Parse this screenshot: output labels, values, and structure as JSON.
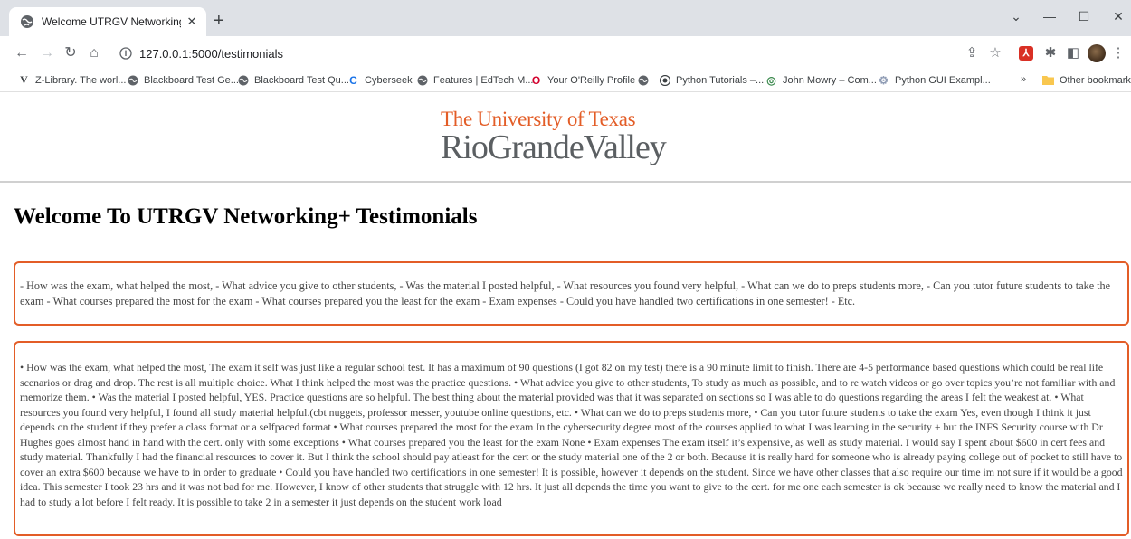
{
  "browser": {
    "tab_title": "Welcome UTRGV Networking+ T",
    "tab_close": "✕",
    "new_tab": "+",
    "url": "127.0.0.1:5000/testimonials",
    "window_controls": {
      "chevron": "⌄",
      "minimize": "—",
      "maximize": "☐",
      "close": "✕"
    },
    "nav": {
      "back": "←",
      "forward": "→",
      "reload": "↻",
      "home": "⌂"
    },
    "toolbar_icons": [
      "share-icon",
      "star-icon",
      "pdf-extension-icon",
      "extensions-puzzle-icon",
      "side-panel-icon",
      "profile-avatar-icon",
      "menu-kebab-icon"
    ],
    "pdf_label": "⅄",
    "bookmarks": [
      {
        "label": "Z-Library. The worl...",
        "icon": "zlibrary-icon"
      },
      {
        "label": "Blackboard Test Ge...",
        "icon": "globe-icon"
      },
      {
        "label": "Blackboard Test Qu...",
        "icon": "globe-icon"
      },
      {
        "label": "Cyberseek",
        "icon": "cyberseek-icon"
      },
      {
        "label": "Features | EdTech M...",
        "icon": "globe-icon"
      },
      {
        "label": "Your O'Reilly Profile",
        "icon": "oreilly-icon"
      },
      {
        "label": "",
        "icon": "globe-icon"
      },
      {
        "label": "Python Tutorials –...",
        "icon": "globe-icon"
      },
      {
        "label": "John Mowry – Com...",
        "icon": "site-icon"
      },
      {
        "label": "Python GUI Exampl...",
        "icon": "python-gui-icon"
      }
    ],
    "overflow": "»",
    "other_bookmarks": "Other bookmarks",
    "colors": {
      "chrome": "#dee1e6",
      "accent_red": "#d93025",
      "folder": "#f9c74f"
    }
  },
  "page": {
    "logo": {
      "line1": "The University of Texas",
      "line2": "RioGrandeValley"
    },
    "heading": "Welcome To UTRGV Networking+ Testimonials",
    "questions": "- How was the exam, what helped the most, - What advice you give to other students, - Was the material I posted helpful, - What resources you found very helpful, - What can we do to preps students more, - Can you tutor future students to take the exam - What courses prepared the most for the exam - What courses prepared you the least for the exam - Exam expenses - Could you have handled two certifications in one semester! - Etc.",
    "testimonial": "• How was the exam, what helped the most, The exam it self was just like a regular school test. It has a maximum of 90 questions (I got 82 on my test) there is a 90 minute limit to finish. There are 4-5 performance based questions which could be real life scenarios or drag and drop. The rest is all multiple choice. What I think helped the most was the practice questions. • What advice you give to other students, To study as much as possible, and to re watch videos or go over topics you’re not familiar with and memorize them. • Was the material I posted helpful, YES. Practice questions are so helpful. The best thing about the material provided was that it was separated on sections so I was able to do questions regarding the areas I felt the weakest at. • What resources you found very helpful, I found all study material helpful.(cbt nuggets, professor messer, youtube online questions, etc. • What can we do to preps students more, • Can you tutor future students to take the exam Yes, even though I think it just depends on the student if they prefer a class format or a selfpaced format • What courses prepared the most for the exam In the cybersecurity degree most of the courses applied to what I was learning in the security + but the INFS Security course with Dr Hughes goes almost hand in hand with the cert. only with some exceptions • What courses prepared you the least for the exam None • Exam expenses The exam itself it’s expensive, as well as study material. I would say I spent about $600 in cert fees and study material. Thankfully I had the financial resources to cover it. But I think the school should pay atleast for the cert or the study material one of the 2 or both. Because it is really hard for someone who is already paying college out of pocket to still have to cover an extra $600 because we have to in order to graduate • Could you have handled two certifications in one semester! It is possible, however it depends on the student. Since we have other classes that also require our time im not sure if it would be a good idea. This semester I took 23 hrs and it was not bad for me. However, I know of other students that struggle with 12 hrs. It just all depends the time you want to give to the cert. for me one each semester is ok because we really need to know the material and I had to study a lot before I felt ready. It is possible to take 2 in a semester it just depends on the student work load",
    "colors": {
      "brand_orange": "#e35d27",
      "brand_gray": "#5b5f62",
      "body_text": "#444444"
    }
  }
}
